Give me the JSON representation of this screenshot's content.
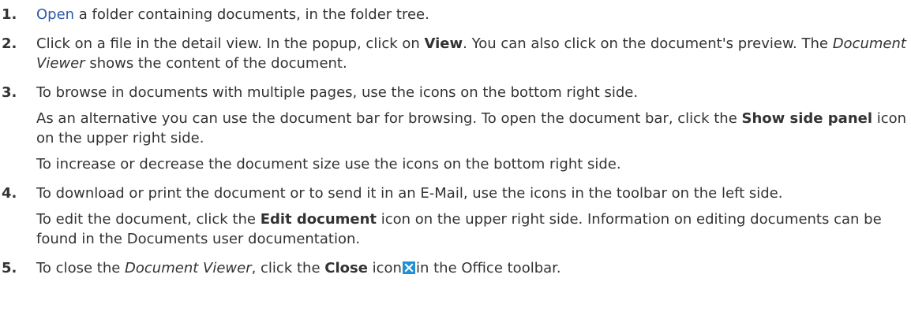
{
  "steps": [
    {
      "num": "1.",
      "link": "Open",
      "text_after": " a folder containing documents, in the folder tree."
    },
    {
      "num": "2.",
      "t1": "Click on a file in the detail view. In the popup, click on ",
      "b1": "View",
      "t2": ". You can also click on the document's preview. The ",
      "i1": "Document Viewer",
      "t3": " shows the content of the document."
    },
    {
      "num": "3.",
      "p1": "To browse in documents with multiple pages, use the icons on the bottom right side.",
      "p2_t1": "As an alternative you can use the document bar for browsing. To open the document bar, click the ",
      "p2_b1": "Show side panel",
      "p2_t2": " icon on the upper right side.",
      "p3": "To increase or decrease the document size use the icons on the bottom right side."
    },
    {
      "num": "4.",
      "p1": "To download or print the document or to send it in an E-Mail, use the icons in the toolbar on the left side.",
      "p2_t1": "To edit the document, click the ",
      "p2_b1": "Edit document",
      "p2_t2": " icon on the upper right side. Information on editing documents can be found in the Documents user documentation."
    },
    {
      "num": "5.",
      "t1": "To close the ",
      "i1": "Document Viewer",
      "t2": ", click the ",
      "b1": "Close",
      "t3": " icon",
      "icon": "close-icon",
      "t4": "in the Office toolbar."
    }
  ],
  "colors": {
    "text": "#333333",
    "link": "#2b5ba8",
    "icon_bg": "#1e90d6"
  }
}
